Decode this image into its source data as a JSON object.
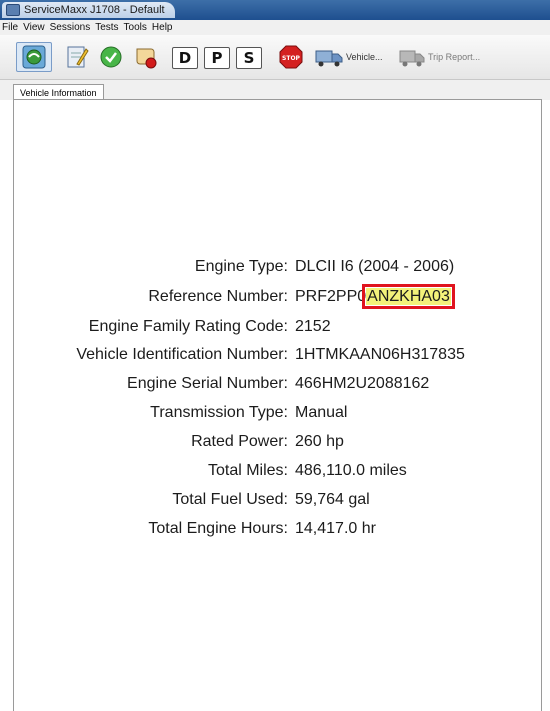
{
  "window": {
    "title": "ServiceMaxx J1708 - Default"
  },
  "menu": [
    "File",
    "View",
    "Sessions",
    "Tests",
    "Tools",
    "Help"
  ],
  "toolbar": {
    "d_label": "D",
    "p_label": "P",
    "s_label": "S",
    "stop_label": "STOP",
    "vehicle_label": "Vehicle...",
    "trip_report_label": "Trip Report..."
  },
  "tabs": [
    {
      "label": "Vehicle Information",
      "active": true
    }
  ],
  "vehicle_info": [
    {
      "label": "Engine Type:",
      "value": "DLCII I6 (2004 - 2006)"
    },
    {
      "label": "Reference Number:",
      "value": "PRF2PP0",
      "value_highlight": "ANZKHA03"
    },
    {
      "label": "Engine Family Rating Code:",
      "value": "2152"
    },
    {
      "label": "Vehicle Identification Number:",
      "value": "1HTMKAAN06H317835"
    },
    {
      "label": "Engine Serial Number:",
      "value": "466HM2U2088162"
    },
    {
      "label": "Transmission Type:",
      "value": "Manual"
    },
    {
      "label": "Rated Power:",
      "value": "260 hp"
    },
    {
      "label": "Total Miles:",
      "value": "486,110.0 miles"
    },
    {
      "label": "Total Fuel Used:",
      "value": "59,764 gal"
    },
    {
      "label": "Total Engine Hours:",
      "value": "14,417.0 hr"
    }
  ],
  "colors": {
    "highlight_fill": "#f3f27a",
    "highlight_border": "#e0141e"
  }
}
